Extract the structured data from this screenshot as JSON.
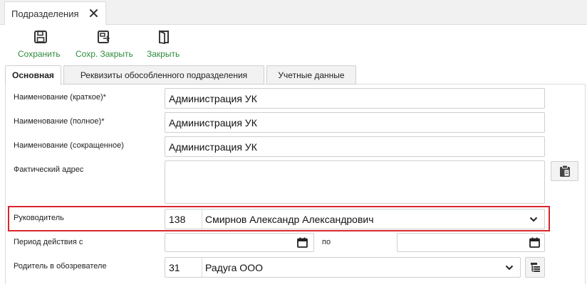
{
  "doc_tab": {
    "title": "Подразделения"
  },
  "toolbar": {
    "save_label": "Сохранить",
    "save_close_label": "Сохр. Закрыть",
    "close_label": "Закрыть",
    "accent_color": "#2e8b3a"
  },
  "tabs": [
    {
      "label": "Основная",
      "active": true
    },
    {
      "label": "Реквизиты обособленного подразделения",
      "active": false
    },
    {
      "label": "Учетные данные",
      "active": false
    }
  ],
  "form": {
    "short_name": {
      "label": "Наименование (краткое)*",
      "value": "Администрация УК"
    },
    "full_name": {
      "label": "Наименование (полное)*",
      "value": "Администрация УК"
    },
    "abbr_name": {
      "label": "Наименование (сокращенное)",
      "value": "Администрация УК"
    },
    "address": {
      "label": "Фактический адрес",
      "value": ""
    },
    "manager": {
      "label": "Руководитель",
      "code": "138",
      "name": "Смирнов Александр Александрович",
      "highlight_color": "#d9262c"
    },
    "period": {
      "label": "Период действия с",
      "from": "",
      "to_label": "по",
      "to": ""
    },
    "parent": {
      "label": "Родитель в обозревателе",
      "code": "31",
      "name": "Радуга ООО"
    }
  },
  "icons": {
    "tab_close": "close-icon",
    "save": "floppy-icon",
    "save_close": "save-close-icon",
    "close": "door-icon",
    "clipboard": "clipboard-icon",
    "calendar": "calendar-icon",
    "dropdown": "chevron-down-icon",
    "tree": "tree-icon"
  }
}
